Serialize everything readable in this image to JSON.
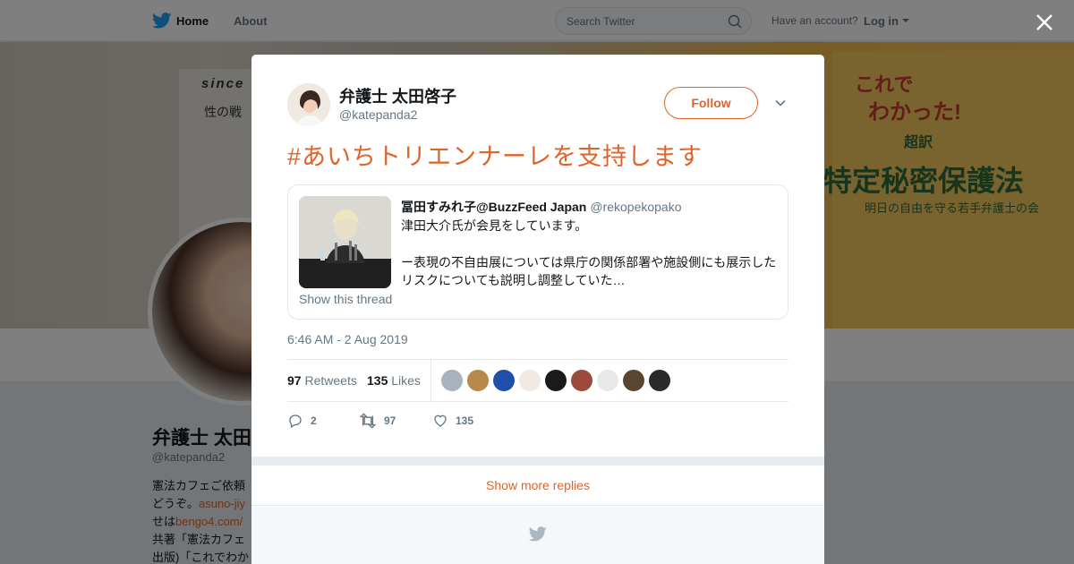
{
  "topbar": {
    "home_label": "Home",
    "about_label": "About",
    "search_placeholder": "Search Twitter",
    "account_question": "Have an account?",
    "login_label": "Log in"
  },
  "banner": {
    "left_text1": "since",
    "left_text2": "性の戦",
    "right_text1": "これで",
    "right_text2": "わかった!",
    "right_text3": "超訳",
    "right_text4": "特定秘密保護法",
    "right_text5": "明日の自由を守る若手弁護士の会"
  },
  "profile": {
    "name": "弁護士 太田",
    "handle": "@katepanda2",
    "bio_line1": "憲法カフェご依頼",
    "bio_line2_pre": "どうぞ。",
    "bio_line2_link": "asuno-jiy",
    "bio_line3_pre": "せは",
    "bio_line3_link": "bengo4.com/",
    "bio_line4": "共著「憲法カフェ",
    "bio_line5": "出版)「これでわか"
  },
  "tweet": {
    "author_name": "弁護士 太田啓子",
    "author_handle": "@katepanda2",
    "follow_label": "Follow",
    "text": "#あいちトリエンナーレを支持します",
    "quote": {
      "author_name": "冨田すみれ子@BuzzFeed Japan",
      "author_handle": "@rekopekopako",
      "line1": "津田大介氏が会見をしています。",
      "line2": "ー表現の不自由展については県庁の関係部署や施設側にも展示したリスクについても説明し調整していた…",
      "show_thread": "Show this thread"
    },
    "timestamp": "6:46 AM - 2 Aug 2019",
    "retweets_count": "97",
    "retweets_label": "Retweets",
    "likes_count": "135",
    "likes_label": "Likes",
    "reply_count": "2",
    "retweet_action_count": "97",
    "like_action_count": "135"
  },
  "modal": {
    "show_more_replies": "Show more replies"
  },
  "colors": {
    "accent": "#e0642a",
    "secondary_text": "#657786",
    "border": "#e1e8ed"
  },
  "likers": [
    "#a9b3bd",
    "#b88a4a",
    "#1f4fa8",
    "#f2e8df",
    "#1a1a1a",
    "#9b4a3c",
    "#e8e8e8",
    "#5a4630",
    "#2a2a2a"
  ]
}
